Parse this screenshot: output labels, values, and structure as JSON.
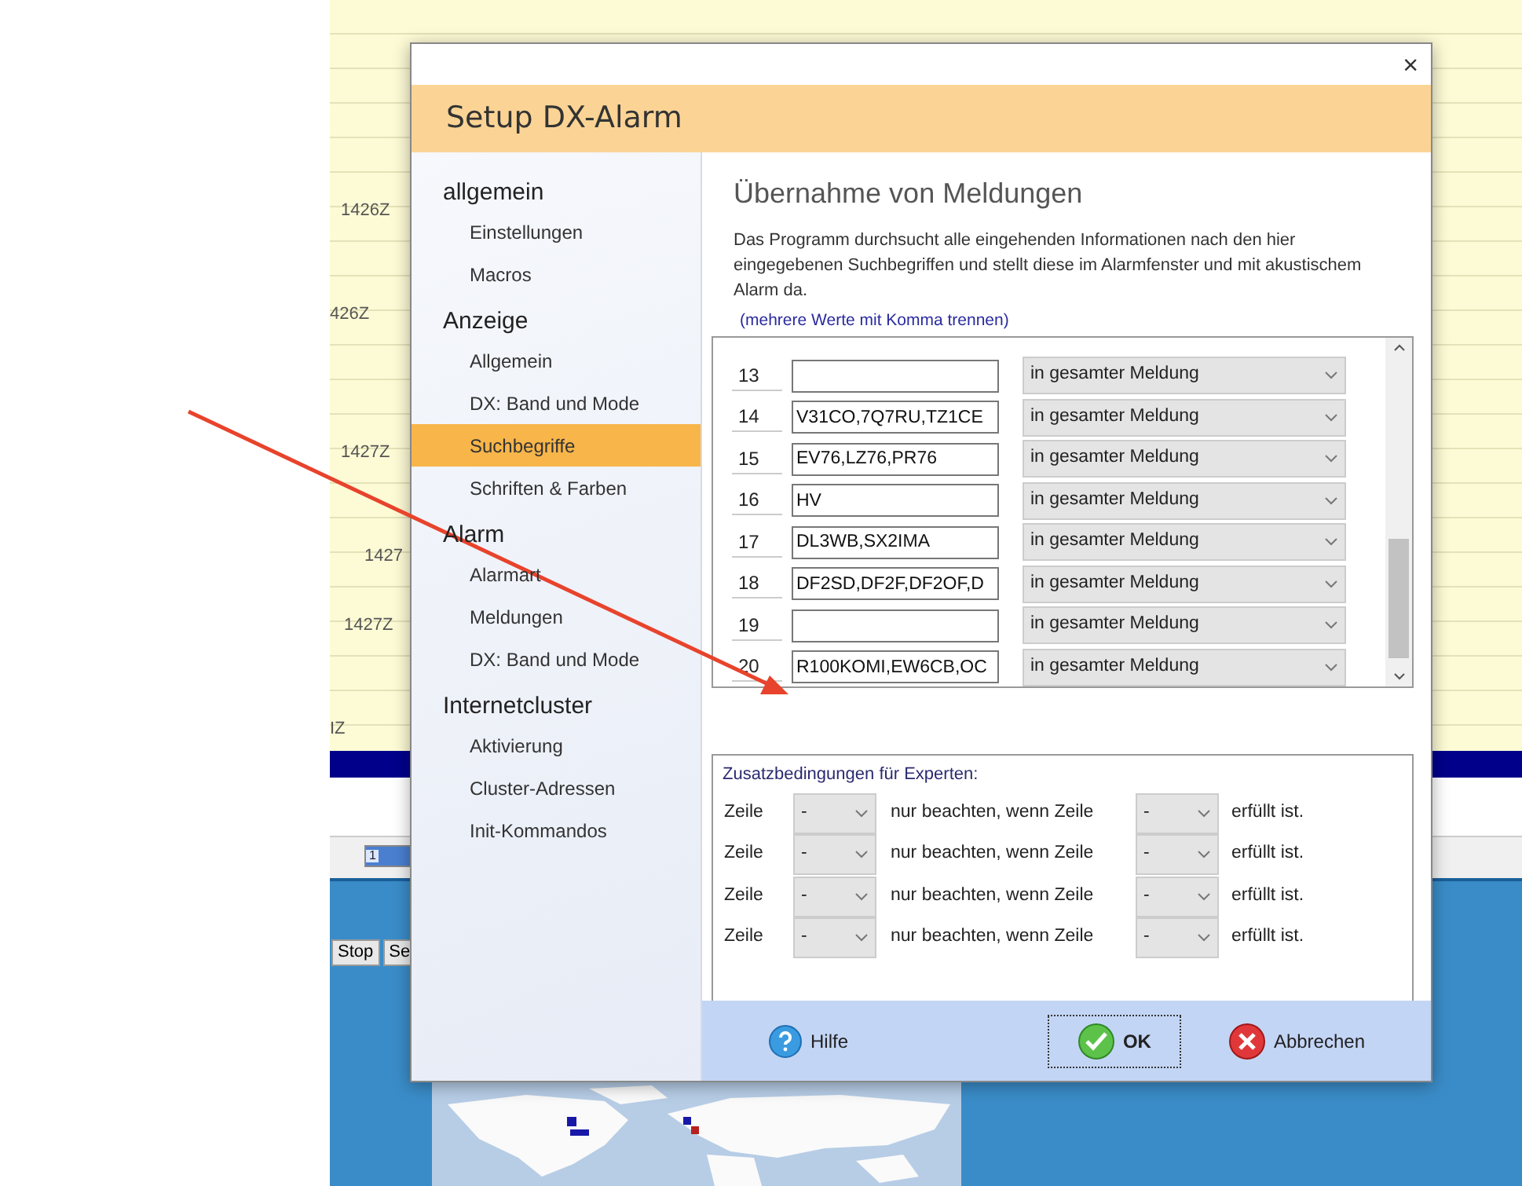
{
  "background": {
    "times": [
      "1426Z",
      "426Z",
      "1427Z",
      "1427",
      "1427Z",
      "IZ"
    ],
    "tab_label": "1",
    "buttons": [
      "Stop",
      "Se"
    ]
  },
  "dialog": {
    "title": "Setup DX-Alarm",
    "close": "×",
    "sidebar": [
      {
        "heading": "allgemein",
        "items": [
          {
            "label": "Einstellungen",
            "selected": false
          },
          {
            "label": "Macros",
            "selected": false
          }
        ]
      },
      {
        "heading": "Anzeige",
        "items": [
          {
            "label": "Allgemein",
            "selected": false
          },
          {
            "label": "DX: Band und Mode",
            "selected": false
          },
          {
            "label": "Suchbegriffe",
            "selected": true
          },
          {
            "label": "Schriften & Farben",
            "selected": false
          }
        ]
      },
      {
        "heading": "Alarm",
        "items": [
          {
            "label": "Alarmart",
            "selected": false
          },
          {
            "label": "Meldungen",
            "selected": false
          },
          {
            "label": "DX: Band und Mode",
            "selected": false
          }
        ]
      },
      {
        "heading": "Internetcluster",
        "items": [
          {
            "label": "Aktivierung",
            "selected": false
          },
          {
            "label": "Cluster-Adressen",
            "selected": false
          },
          {
            "label": "Init-Kommandos",
            "selected": false
          }
        ]
      }
    ],
    "heading": "Übernahme von Meldungen",
    "description": "Das Programm durchsucht alle eingehenden Informationen nach den hier eingegebenen Suchbegriffen und stellt diese im Alarmfenster und mit akustischem Alarm da.",
    "hint": "(mehrere Werte mit Komma trennen)",
    "rows": [
      {
        "number": "13",
        "value": "",
        "scope": "in gesamter Meldung"
      },
      {
        "number": "14",
        "value": "V31CO,7Q7RU,TZ1CE",
        "scope": "in gesamter Meldung"
      },
      {
        "number": "15",
        "value": "EV76,LZ76,PR76",
        "scope": "in gesamter Meldung"
      },
      {
        "number": "16",
        "value": "HV",
        "scope": "in gesamter Meldung"
      },
      {
        "number": "17",
        "value": "DL3WB,SX2IMA",
        "scope": "in gesamter Meldung"
      },
      {
        "number": "18",
        "value": "DF2SD,DF2F,DF2OF,D",
        "scope": "in gesamter Meldung"
      },
      {
        "number": "19",
        "value": "",
        "scope": "in gesamter Meldung"
      },
      {
        "number": "20",
        "value": "R100KOMI,EW6CB,OC",
        "scope": "in gesamter Meldung"
      }
    ],
    "expert": {
      "title": "Zusatzbedingungen für Experten:",
      "rows": [
        {
          "label": "Zeile",
          "line": "-",
          "middle": "nur beachten, wenn Zeile",
          "condition": "-",
          "end": "erfüllt ist."
        },
        {
          "label": "Zeile",
          "line": "-",
          "middle": "nur beachten, wenn Zeile",
          "condition": "-",
          "end": "erfüllt ist."
        },
        {
          "label": "Zeile",
          "line": "-",
          "middle": "nur beachten, wenn Zeile",
          "condition": "-",
          "end": "erfüllt ist."
        },
        {
          "label": "Zeile",
          "line": "-",
          "middle": "nur beachten, wenn Zeile",
          "condition": "-",
          "end": "erfüllt ist."
        }
      ]
    },
    "buttons": [
      {
        "kind": "help",
        "label": "Hilfe"
      },
      {
        "kind": "ok",
        "label": "OK"
      },
      {
        "kind": "cancel",
        "label": "Abbrechen"
      }
    ]
  }
}
